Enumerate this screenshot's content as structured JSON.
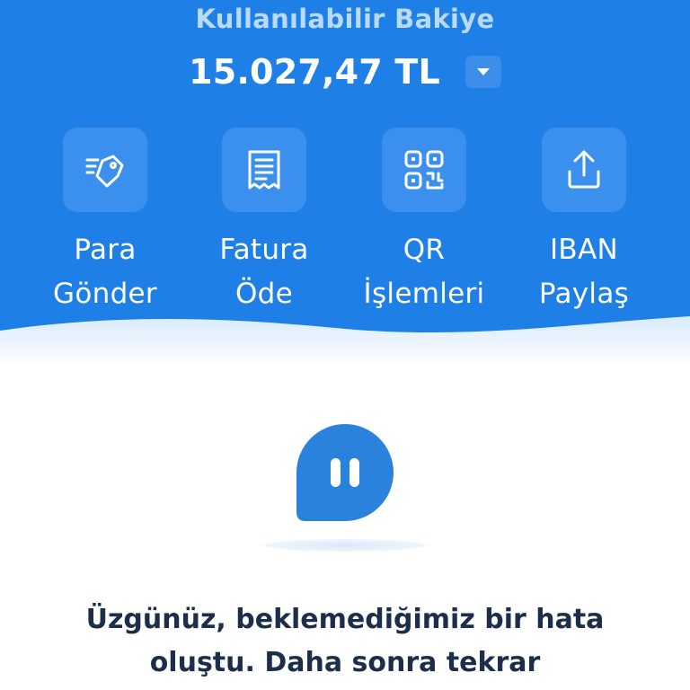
{
  "balance": {
    "label": "Kullanılabilir Bakiye",
    "amount": "15.027,47 TL",
    "toggle_icon": "chevron-down-icon"
  },
  "actions": [
    {
      "label": "Para\nGönder",
      "icon": "send-money-icon"
    },
    {
      "label": "Fatura\nÖde",
      "icon": "bill-receipt-icon"
    },
    {
      "label": "QR\nİşlemleri",
      "icon": "qr-code-icon"
    },
    {
      "label": "IBAN\nPaylaş",
      "icon": "share-upload-icon"
    }
  ],
  "error": {
    "icon": "paused-chat-bubble-icon",
    "message": "Üzgünüz, beklemediğimiz bir hata oluştu. Daha sonra tekrar"
  },
  "colors": {
    "header_blue": "#1e7fe6",
    "tile_blue": "#3a90ec",
    "label_light_blue": "#b9dafc",
    "text_dark": "#1c2e4a"
  }
}
